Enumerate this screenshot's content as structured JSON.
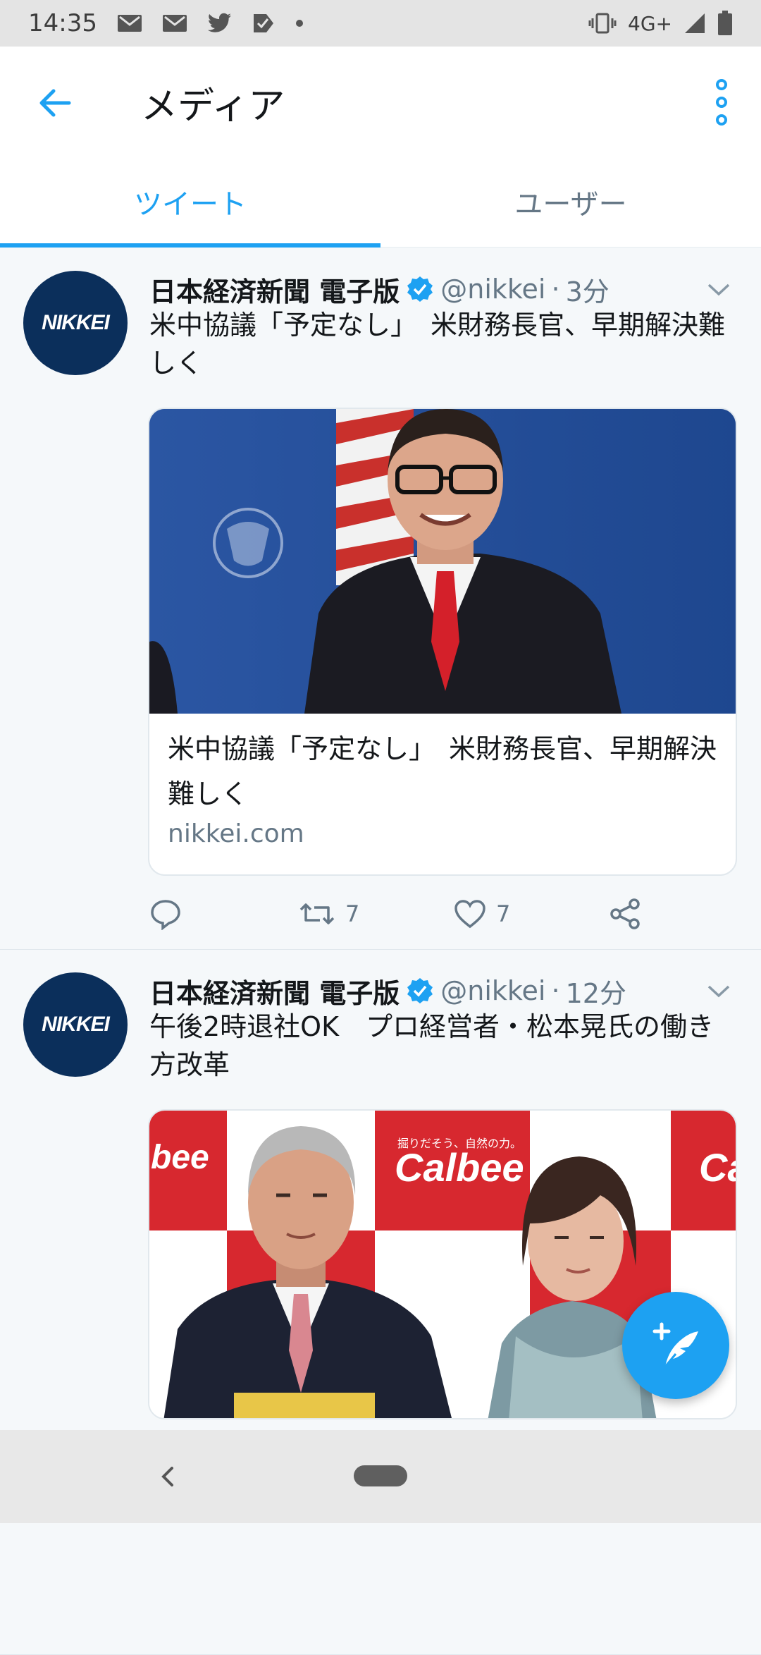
{
  "status_bar": {
    "time": "14:35",
    "network": "4G+",
    "icons": [
      "gmail-icon",
      "gmail-icon",
      "twitter-icon",
      "tasks-icon",
      "dot-icon",
      "vibrate-icon",
      "signal-icon",
      "battery-icon"
    ]
  },
  "app_bar": {
    "title": "メディア",
    "back_icon": "arrow-left-icon",
    "more_icon": "more-vertical-icon"
  },
  "tabs": [
    {
      "label": "ツイート",
      "active": true
    },
    {
      "label": "ユーザー",
      "active": false
    }
  ],
  "tweets": [
    {
      "avatar_text": "NIKKEI",
      "name": "日本経済新聞 電子版",
      "handle": "@nikkei",
      "separator": "·",
      "time": "3分",
      "text": "米中協議「予定なし」　米財務長官、早期解決難しく",
      "card": {
        "title": "米中協議「予定なし」　米財務長官、早期解決難しく",
        "domain": "nikkei.com"
      },
      "retweets": "7",
      "likes": "7"
    },
    {
      "avatar_text": "NIKKEI",
      "name": "日本経済新聞 電子版",
      "handle": "@nikkei",
      "separator": "·",
      "time": "12分",
      "text": "午後2時退社OK　プロ経営者・松本晃氏の働き方改革",
      "card": {
        "image_texts": [
          "Calbee",
          "bee",
          "Ca",
          "掘りだそう、自然の力。"
        ]
      }
    }
  ],
  "colors": {
    "accent": "#1da1f2",
    "nikkei_blue": "#0b2f5b",
    "calbee_red": "#d7282f"
  }
}
